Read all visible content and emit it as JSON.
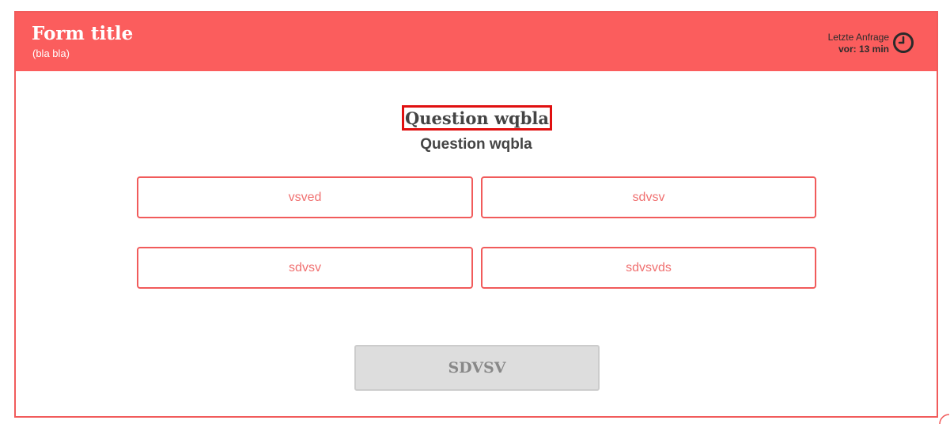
{
  "header": {
    "title": "Form title",
    "subtitle": "(bla bla)",
    "last_request_line1": "Letzte Anfrage",
    "last_request_line2": "vor: 13 min",
    "clock_icon": "clock-icon",
    "background_color": "#fb5d5d"
  },
  "question": {
    "title": "Question wqbla",
    "subtitle": "Question wqbla"
  },
  "options": [
    {
      "label": "vsved"
    },
    {
      "label": "sdvsv"
    },
    {
      "label": "sdvsv"
    },
    {
      "label": "sdvsvds"
    }
  ],
  "submit": {
    "label": "SDVSV"
  },
  "colors": {
    "accent": "#f15b5b",
    "option_text": "#f07070",
    "highlight_box": "#e01010",
    "submit_bg": "#dddddd"
  }
}
